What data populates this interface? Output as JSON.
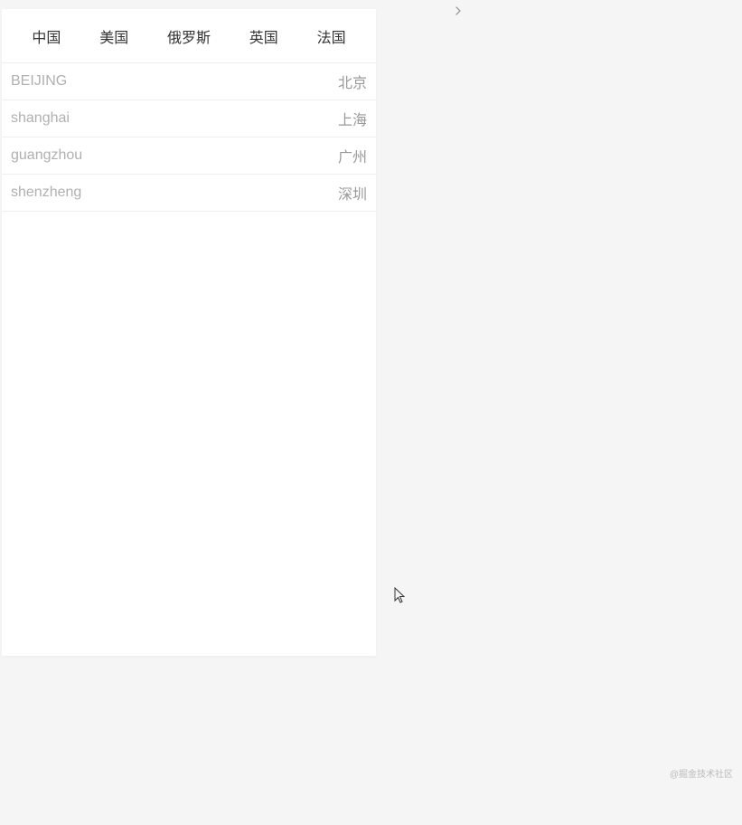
{
  "tabs": [
    {
      "label": "中国"
    },
    {
      "label": "美国"
    },
    {
      "label": "俄罗斯"
    },
    {
      "label": "英国"
    },
    {
      "label": "法国"
    }
  ],
  "cities": [
    {
      "pinyin": "BEIJING",
      "chinese": "北京"
    },
    {
      "pinyin": "shanghai",
      "chinese": "上海"
    },
    {
      "pinyin": "guangzhou",
      "chinese": "广州"
    },
    {
      "pinyin": "shenzheng",
      "chinese": "深圳"
    }
  ],
  "watermark": "@掘金技术社区"
}
